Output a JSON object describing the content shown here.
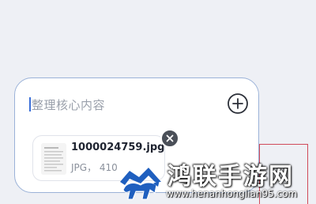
{
  "composer": {
    "placeholder": "整理核心内容",
    "add_icon": "plus-circle-icon",
    "attachment": {
      "file_name": "1000024759.jpg",
      "file_meta": "JPG， 410",
      "thumbnail_icon": "document-thumbnail-icon",
      "remove_icon": "close-icon"
    }
  },
  "watermark": {
    "title": "鸿联手游网",
    "url": "www.henanhonglian95.com"
  },
  "colors": {
    "background": "#eef0f5",
    "composer_border": "#9bb2d8",
    "caret": "#3b6fd8",
    "side_frame": "#d04a5a",
    "watermark_blue": "#1f5fbf"
  }
}
